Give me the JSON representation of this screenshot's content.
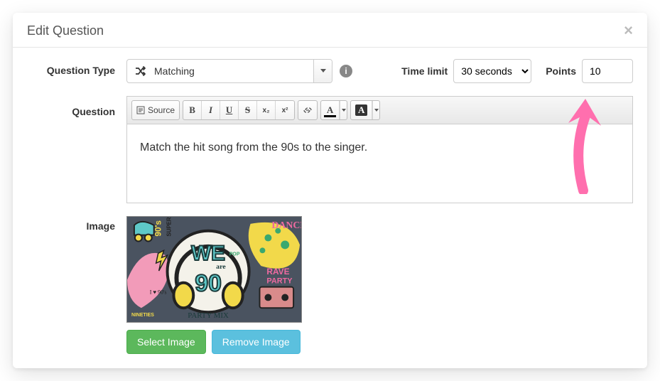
{
  "modal": {
    "title": "Edit Question",
    "close_glyph": "×"
  },
  "qtype": {
    "label": "Question Type",
    "selected": "Matching"
  },
  "timelimit": {
    "label": "Time limit",
    "selected": "30 seconds"
  },
  "points": {
    "label": "Points",
    "value": "10"
  },
  "question": {
    "label": "Question",
    "toolbar": {
      "source": "Source",
      "bold": "B",
      "italic": "I",
      "underline": "U",
      "strike": "S",
      "sub": "x₂",
      "sup": "x²",
      "textcolor": "A",
      "bgcolor": "A"
    },
    "body": "Match the hit song from the 90s to the singer."
  },
  "image": {
    "label": "Image",
    "select_btn": "Select Image",
    "remove_btn": "Remove Image",
    "art_text": {
      "we": "WE",
      "are": "are",
      "ninety": "90",
      "dance": "DANCE",
      "rave": "RAVE",
      "party": "PARTY",
      "mix": "PARTY MIX",
      "pop": "POP",
      "ninetiestext": "90's",
      "super": "SUPER HITS",
      "heart": "I ♥ 90's",
      "corner": "NINETIES"
    }
  }
}
